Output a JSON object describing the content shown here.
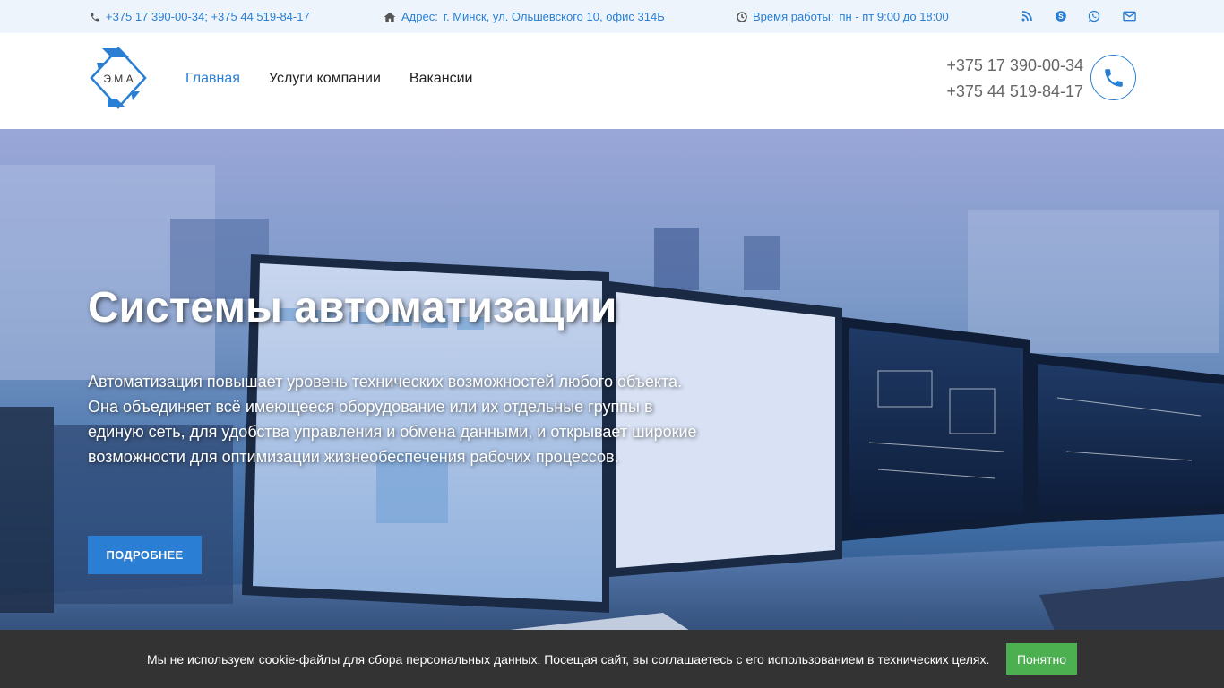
{
  "topbar": {
    "phones": "+375 17 390-00-34;  +375 44 519-84-17",
    "address_label": "Адрес:",
    "address": "г. Минск, ул. Ольшевского 10, офис 314Б",
    "hours_label": "Время работы:",
    "hours": "пн - пт 9:00 до 18:00",
    "icons": [
      "phone-icon",
      "home-icon",
      "clock-icon",
      "rss-icon",
      "skype-icon",
      "whatsapp-icon",
      "envelope-icon"
    ]
  },
  "header": {
    "logo_text": "Э.М.А",
    "nav": [
      {
        "label": "Главная",
        "active": true
      },
      {
        "label": "Услуги компании",
        "active": false
      },
      {
        "label": "Вакансии",
        "active": false
      }
    ],
    "phone1": "+375 17 390-00-34",
    "phone2": "+375 44 519-84-17"
  },
  "hero": {
    "title": "Системы автоматизации",
    "text": "Автоматизация повышает уровень технических возможностей любого объекта. Она объединяет всё имеющееся оборудование или их отдельные группы в единую сеть, для удобства управления и обмена данными, и открывает широкие возможности для оптимизации жизнеобеспечения рабочих процессов.",
    "button": "ПОДРОБНЕЕ"
  },
  "cookie": {
    "text": "Мы не используем cookie-файлы для сбора персональных данных. Посещая сайт, вы соглашаетесь с его использованием в технических целях.",
    "button": "Понятно"
  },
  "colors": {
    "accent": "#2a7fd4",
    "topbar_bg": "#eef4fb",
    "cookie_bg": "#333333",
    "cookie_button": "#4caf50"
  }
}
